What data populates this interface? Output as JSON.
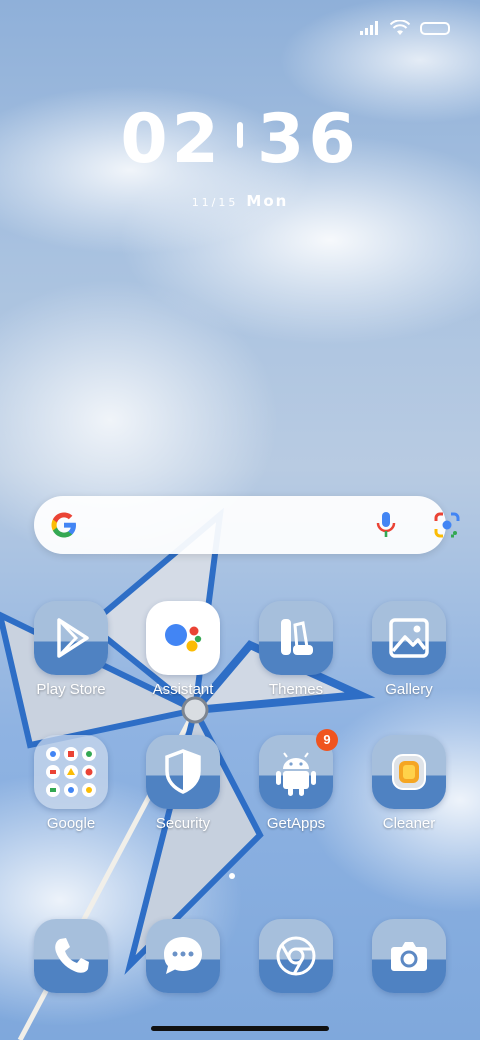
{
  "status_bar": {
    "icons": [
      "signal-icon",
      "wifi-icon",
      "battery-icon"
    ]
  },
  "clock": {
    "hours": "02",
    "minutes": "36",
    "date": "11/15",
    "weekday": "Mon"
  },
  "search_bar": {
    "icons": [
      "google-logo-icon",
      "microphone-icon",
      "google-lens-icon"
    ]
  },
  "apps": {
    "row1": [
      {
        "label": "Play Store",
        "icon": "play-store-icon"
      },
      {
        "label": "Assistant",
        "icon": "assistant-icon"
      },
      {
        "label": "Themes",
        "icon": "themes-icon"
      },
      {
        "label": "Gallery",
        "icon": "gallery-icon"
      }
    ],
    "row2": [
      {
        "label": "Google",
        "icon": "google-folder-icon"
      },
      {
        "label": "Security",
        "icon": "shield-icon"
      },
      {
        "label": "GetApps",
        "icon": "android-icon",
        "badge": "9"
      },
      {
        "label": "Cleaner",
        "icon": "cleaner-icon"
      }
    ]
  },
  "dock": [
    {
      "icon": "phone-icon"
    },
    {
      "icon": "messages-icon"
    },
    {
      "icon": "chrome-icon"
    },
    {
      "icon": "camera-icon"
    }
  ],
  "colors": {
    "tile_light": "#a6bfdc",
    "tile_dark": "#4f82c2",
    "badge": "#f0541f",
    "sky": "#8fb3e2"
  }
}
